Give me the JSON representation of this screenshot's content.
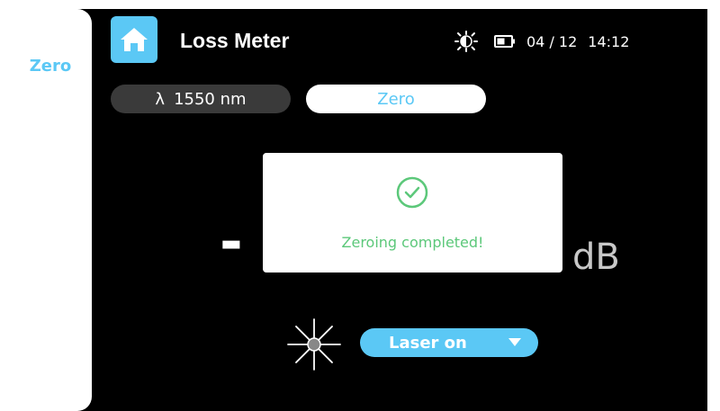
{
  "sidebar": {
    "items": [
      {
        "label": "Zero"
      }
    ]
  },
  "header": {
    "title": "Loss Meter",
    "home_icon": "home-icon",
    "status": {
      "brightness_icon": "brightness-icon",
      "battery_icon": "battery-icon",
      "date": "04 / 12",
      "time": "14:12"
    }
  },
  "controls": {
    "wavelength_symbol": "λ",
    "wavelength_value": "1550 nm",
    "zero_label": "Zero"
  },
  "measurement": {
    "value_visible": "-",
    "unit": "dB"
  },
  "dialog": {
    "icon": "check-circle-icon",
    "message": "Zeroing completed!"
  },
  "laser": {
    "icon": "laser-icon",
    "label": "Laser on",
    "dropdown_icon": "chevron-down-icon"
  },
  "colors": {
    "accent": "#5bc8f5",
    "success": "#5cc87a",
    "background": "#000000",
    "pill_dark": "#3a3a3a"
  }
}
